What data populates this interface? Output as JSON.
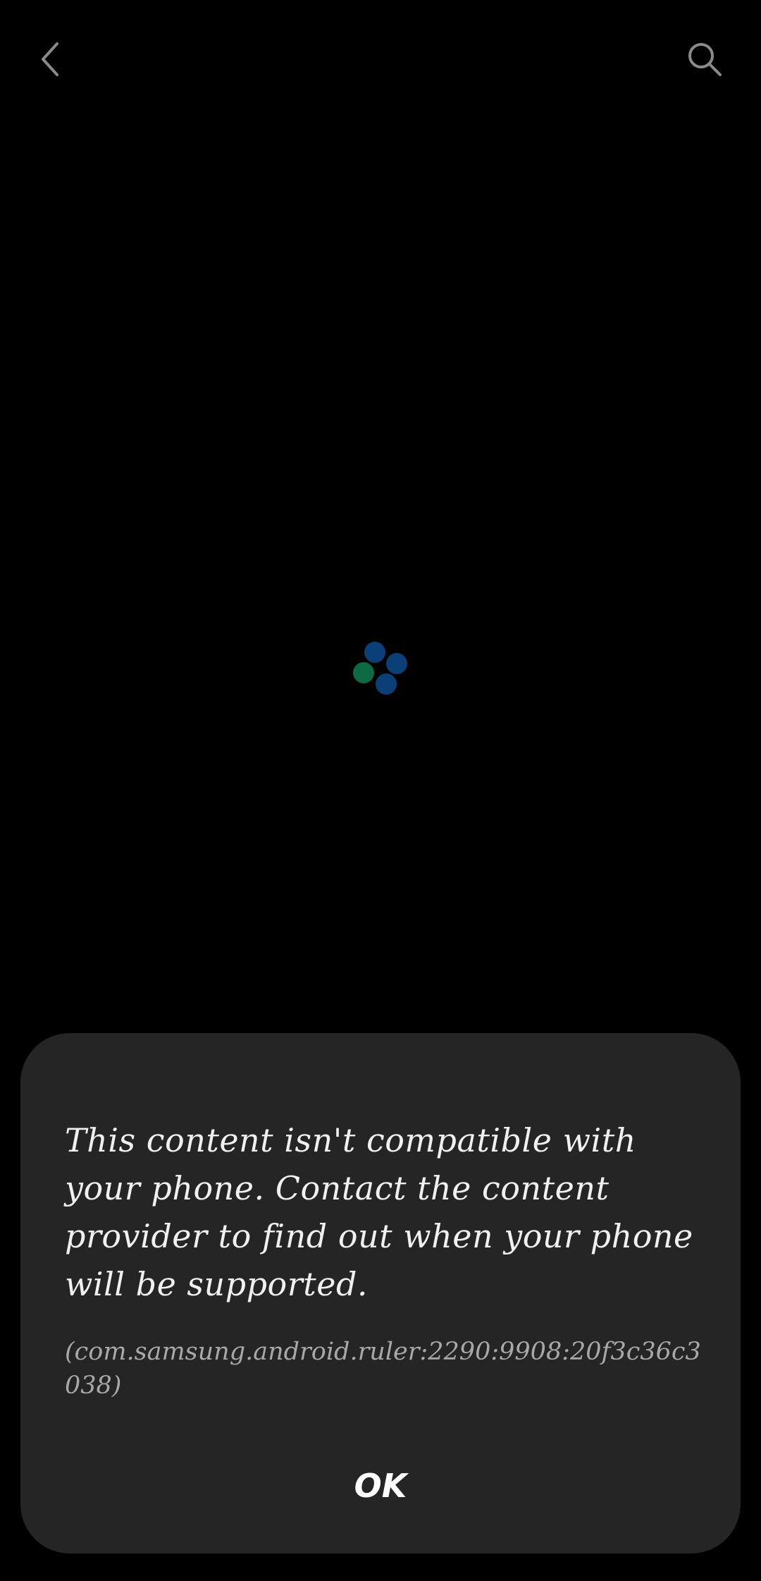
{
  "colors": {
    "background": "#000000",
    "dialog_background": "#252525",
    "icon_color": "#8a8a8a",
    "spinner_blue": "#0b3f78",
    "spinner_green": "#0e6a44"
  },
  "topbar": {
    "back_icon": "chevron-left-icon",
    "search_icon": "search-icon"
  },
  "spinner": {
    "icon": "loading-spinner-icon"
  },
  "dialog": {
    "message": "This content isn't compatible with your phone. Contact the content provider to find out when your phone will be supported.",
    "code": "(com.samsung.android.ruler:2290:9908:20f3c36c3038)",
    "ok_label": "OK"
  }
}
